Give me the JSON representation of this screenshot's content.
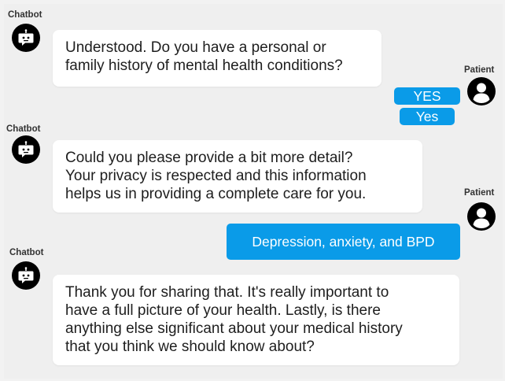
{
  "chat": {
    "bot_label": "Chatbot",
    "patient_label": "Patient",
    "messages": [
      {
        "sender": "bot",
        "lines": [
          "Understood. Do you have a personal or",
          "family history of mental health conditions?"
        ]
      },
      {
        "sender": "patient",
        "bubbles": [
          "YES",
          "Yes"
        ]
      },
      {
        "sender": "bot",
        "lines": [
          "Could you please provide a bit more detail?",
          "Your privacy is respected and this information",
          "helps us in providing a complete care for you."
        ]
      },
      {
        "sender": "patient",
        "bubbles": [
          "Depression, anxiety, and BPD"
        ]
      },
      {
        "sender": "bot",
        "lines": [
          "Thank you for sharing that. It's really important to",
          "have a full picture of your health. Lastly, is there",
          "anything else significant about your medical history",
          "that you think we should know about?"
        ]
      }
    ]
  },
  "icons": {
    "bot_avatar": "robot-chat-icon",
    "patient_avatar": "user-profile-icon"
  },
  "colors": {
    "background": "#efefef",
    "bot_bubble": "#ffffff",
    "user_bubble": "#0a9be8",
    "avatar": "#000000"
  }
}
